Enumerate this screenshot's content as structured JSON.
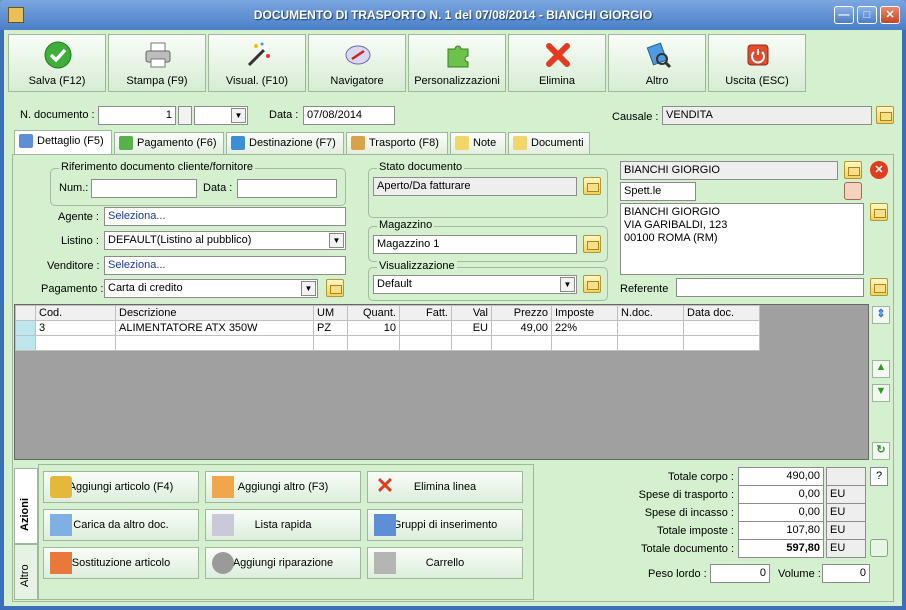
{
  "window": {
    "title": "DOCUMENTO DI TRASPORTO N. 1 del 07/08/2014 - BIANCHI GIORGIO",
    "min": "—",
    "max": "□",
    "close": "✕"
  },
  "toolbar": [
    {
      "label": "Salva (F12)",
      "icon": "checkmark-icon"
    },
    {
      "label": "Stampa (F9)",
      "icon": "printer-icon"
    },
    {
      "label": "Visual. (F10)",
      "icon": "magic-wand-icon"
    },
    {
      "label": "Navigatore",
      "icon": "compass-icon"
    },
    {
      "label": "Personalizzazioni",
      "icon": "puzzle-icon"
    },
    {
      "label": "Elimina",
      "icon": "red-x-icon"
    },
    {
      "label": "Altro",
      "icon": "tools-icon"
    },
    {
      "label": "Uscita (ESC)",
      "icon": "power-icon"
    }
  ],
  "header": {
    "ndoc_label": "N. documento :",
    "ndoc_value": "1",
    "data_label": "Data :",
    "data_value": "07/08/2014",
    "causale_label": "Causale :",
    "causale_value": "VENDITA"
  },
  "tabs": [
    "Dettaglio (F5)",
    "Pagamento (F6)",
    "Destinazione (F7)",
    "Trasporto (F8)",
    "Note",
    "Documenti"
  ],
  "riferimento": {
    "title": "Riferimento documento cliente/fornitore",
    "num_label": "Num.:",
    "data_label": "Data :"
  },
  "form": {
    "agente_label": "Agente :",
    "agente_value": "Seleziona...",
    "listino_label": "Listino :",
    "listino_value": "DEFAULT(Listino al pubblico)",
    "venditore_label": "Venditore :",
    "venditore_value": "Seleziona...",
    "pagamento_label": "Pagamento :",
    "pagamento_value": "Carta di credito"
  },
  "stato": {
    "title": "Stato documento",
    "value": "Aperto/Da fatturare"
  },
  "magazzino": {
    "title": "Magazzino",
    "value": "Magazzino 1"
  },
  "visualizzazione": {
    "title": "Visualizzazione",
    "value": "Default"
  },
  "cliente": {
    "name": "BIANCHI GIORGIO",
    "salutation": "Spett.le",
    "address_lines": [
      "BIANCHI GIORGIO",
      "VIA GARIBALDI, 123",
      "00100 ROMA (RM)"
    ],
    "referente_label": "Referente"
  },
  "grid": {
    "columns": [
      "Cod.",
      "Descrizione",
      "UM",
      "Quant.",
      "Fatt.",
      "Val",
      "Prezzo",
      "Imposte",
      "N.doc.",
      "Data doc."
    ],
    "rows": [
      [
        "3",
        "ALIMENTATORE ATX 350W",
        "PZ",
        "10",
        "",
        "EU",
        "49,00",
        "22%",
        "",
        ""
      ],
      [
        "",
        "",
        "",
        "",
        "",
        "",
        "",
        "",
        "",
        ""
      ]
    ]
  },
  "actions": {
    "vtab_azioni": "Azioni",
    "vtab_altro": "Altro",
    "buttons": [
      {
        "label": "Aggiungi articolo (F4)",
        "icon": "add-article-icon"
      },
      {
        "label": "Aggiungi altro (F3)",
        "icon": "add-other-icon"
      },
      {
        "label": "Elimina linea",
        "icon": "delete-line-icon"
      },
      {
        "label": "Carica da altro doc.",
        "icon": "load-doc-icon"
      },
      {
        "label": "Lista rapida",
        "icon": "quick-list-icon"
      },
      {
        "label": "Gruppi di inserimento",
        "icon": "insert-groups-icon"
      },
      {
        "label": "Sostituzione articolo",
        "icon": "replace-article-icon"
      },
      {
        "label": "Aggiungi riparazione",
        "icon": "wrench-icon"
      },
      {
        "label": "Carrello",
        "icon": "cart-icon"
      }
    ]
  },
  "totals": {
    "corpo_label": "Totale corpo :",
    "corpo_value": "490,00",
    "help": "?",
    "trasporto_label": "Spese di trasporto :",
    "trasporto_value": "0,00",
    "trasporto_val": "EU",
    "incasso_label": "Spese di incasso :",
    "incasso_value": "0,00",
    "incasso_val": "EU",
    "imposte_label": "Totale imposte :",
    "imposte_value": "107,80",
    "imposte_val": "EU",
    "documento_label": "Totale documento :",
    "documento_value": "597,80",
    "documento_val": "EU",
    "peso_label": "Peso lordo :",
    "peso_value": "0",
    "volume_label": "Volume :",
    "volume_value": "0"
  }
}
